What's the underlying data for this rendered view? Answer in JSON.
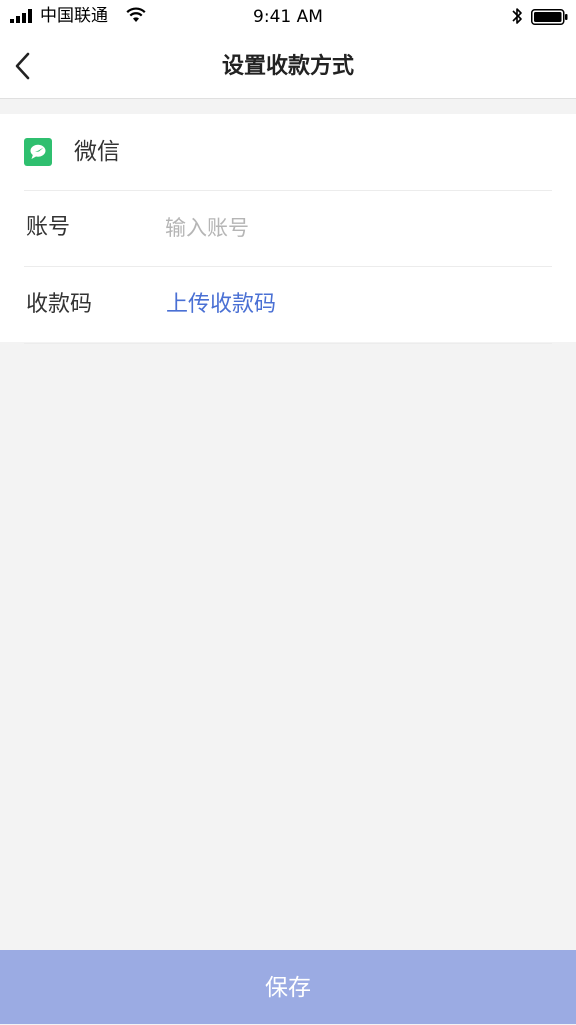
{
  "status_bar": {
    "carrier": "中国联通",
    "time": "9:41 AM"
  },
  "nav": {
    "title": "设置收款方式"
  },
  "form": {
    "payment_method": "微信",
    "account_label": "账号",
    "account_value": "",
    "account_placeholder": "输入账号",
    "qrcode_label": "收款码",
    "upload_link": "上传收款码"
  },
  "footer": {
    "save_label": "保存"
  },
  "colors": {
    "wechat_green": "#2fbf6f",
    "link_blue": "#4a70d4",
    "save_button": "#9babe3",
    "background": "#f3f3f3"
  }
}
